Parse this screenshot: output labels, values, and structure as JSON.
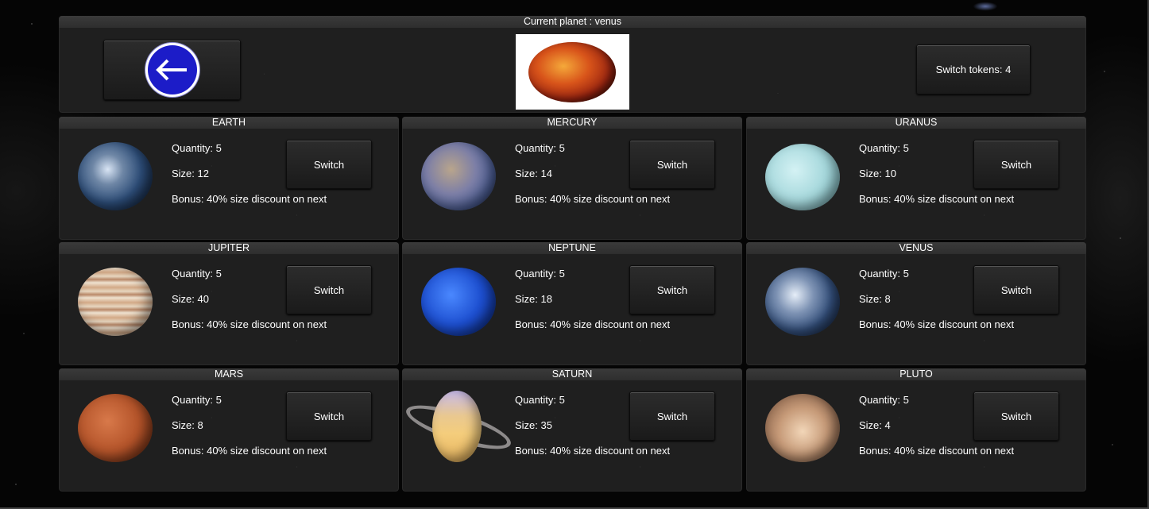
{
  "header": {
    "title": "Current planet : venus",
    "back_icon": "arrow-left-icon",
    "tokens_label": "Switch tokens: 4",
    "current_planet": "venus"
  },
  "planets": [
    {
      "name": "EARTH",
      "quantity": "Quantity: 5",
      "size": "Size: 12",
      "bonus": "Bonus: 40% size discount on next",
      "button": "Switch"
    },
    {
      "name": "MERCURY",
      "quantity": "Quantity: 5",
      "size": "Size: 14",
      "bonus": "Bonus: 40% size discount on next",
      "button": "Switch"
    },
    {
      "name": "URANUS",
      "quantity": "Quantity: 5",
      "size": "Size: 10",
      "bonus": "Bonus: 40% size discount on next",
      "button": "Switch"
    },
    {
      "name": "JUPITER",
      "quantity": "Quantity: 5",
      "size": "Size: 40",
      "bonus": "Bonus: 40% size discount on next",
      "button": "Switch"
    },
    {
      "name": "NEPTUNE",
      "quantity": "Quantity: 5",
      "size": "Size: 18",
      "bonus": "Bonus: 40% size discount on next",
      "button": "Switch"
    },
    {
      "name": "VENUS",
      "quantity": "Quantity: 5",
      "size": "Size: 8",
      "bonus": "Bonus: 40% size discount on next",
      "button": "Switch"
    },
    {
      "name": "MARS",
      "quantity": "Quantity: 5",
      "size": "Size: 8",
      "bonus": "Bonus: 40% size discount on next",
      "button": "Switch"
    },
    {
      "name": "SATURN",
      "quantity": "Quantity: 5",
      "size": "Size: 35",
      "bonus": "Bonus: 40% size discount on next",
      "button": "Switch"
    },
    {
      "name": "PLUTO",
      "quantity": "Quantity: 5",
      "size": "Size: 4",
      "bonus": "Bonus: 40% size discount on next",
      "button": "Switch"
    }
  ],
  "colors": {
    "panel_bg": "#1f1f1f",
    "title_bar": "#333333",
    "text": "#ffffff",
    "back_button_blue": "#1c1cc8"
  }
}
